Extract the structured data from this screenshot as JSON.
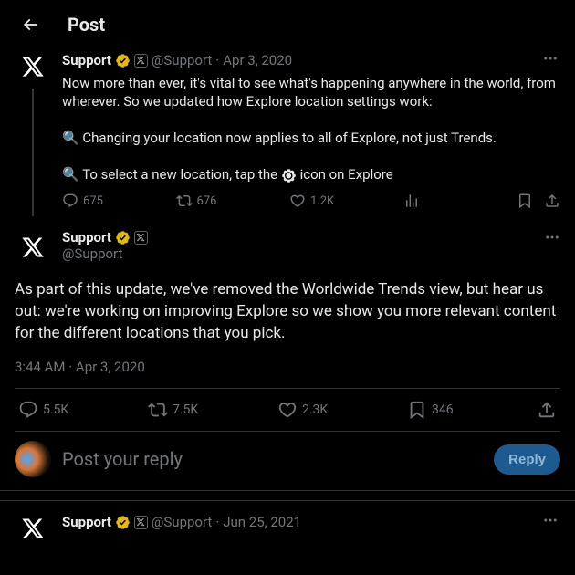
{
  "header": {
    "title": "Post"
  },
  "parent": {
    "name": "Support",
    "handle": "@Support",
    "sep": "·",
    "date": "Apr 3, 2020",
    "text_line1": "Now more than ever, it's vital to see what's happening anywhere in the world, from wherever. So we updated how Explore location settings work:",
    "bullet1_pre": "🔍 ",
    "bullet1": "Changing your location now applies to all of Explore, not just Trends.",
    "bullet2_pre": "🔍 ",
    "bullet2a": "To select a new location, tap the ",
    "bullet2b": " icon on Explore",
    "replies": "675",
    "reposts": "676",
    "likes": "1.2K"
  },
  "main": {
    "name": "Support",
    "handle": "@Support",
    "text": "As part of this update, we've removed the Worldwide Trends view, but hear us out: we're working on improving Explore so we show you more relevant content for the different locations that you pick.",
    "time": "3:44 AM",
    "sep": "·",
    "date": "Apr 3, 2020",
    "replies": "5.5K",
    "reposts": "7.5K",
    "likes": "2.3K",
    "bookmarks": "346"
  },
  "reply": {
    "placeholder": "Post your reply",
    "button": "Reply"
  },
  "next": {
    "name": "Support",
    "handle": "@Support",
    "sep": "·",
    "date": "Jun 25, 2021"
  }
}
